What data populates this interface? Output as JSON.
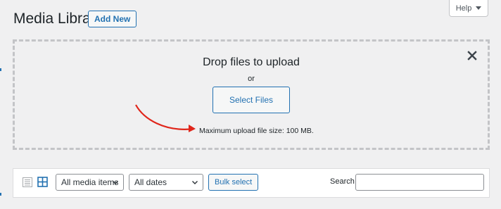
{
  "header": {
    "title": "Media Library",
    "add_new_label": "Add New",
    "help_label": "Help"
  },
  "uploader": {
    "drop_title": "Drop files to upload",
    "or_text": "or",
    "select_files_label": "Select Files",
    "max_size_text": "Maximum upload file size: 100 MB.",
    "close_icon": "close-icon",
    "annotation_arrow_color": "#e0261b"
  },
  "toolbar": {
    "list_view_icon": "list-view-icon",
    "grid_view_icon": "grid-view-icon",
    "media_filter_value": "All media items",
    "date_filter_value": "All dates",
    "bulk_select_label": "Bulk select",
    "search_label": "Search",
    "search_value": ""
  },
  "colors": {
    "accent": "#2271b1",
    "background": "#f0f0f1",
    "text": "#1d2327"
  }
}
